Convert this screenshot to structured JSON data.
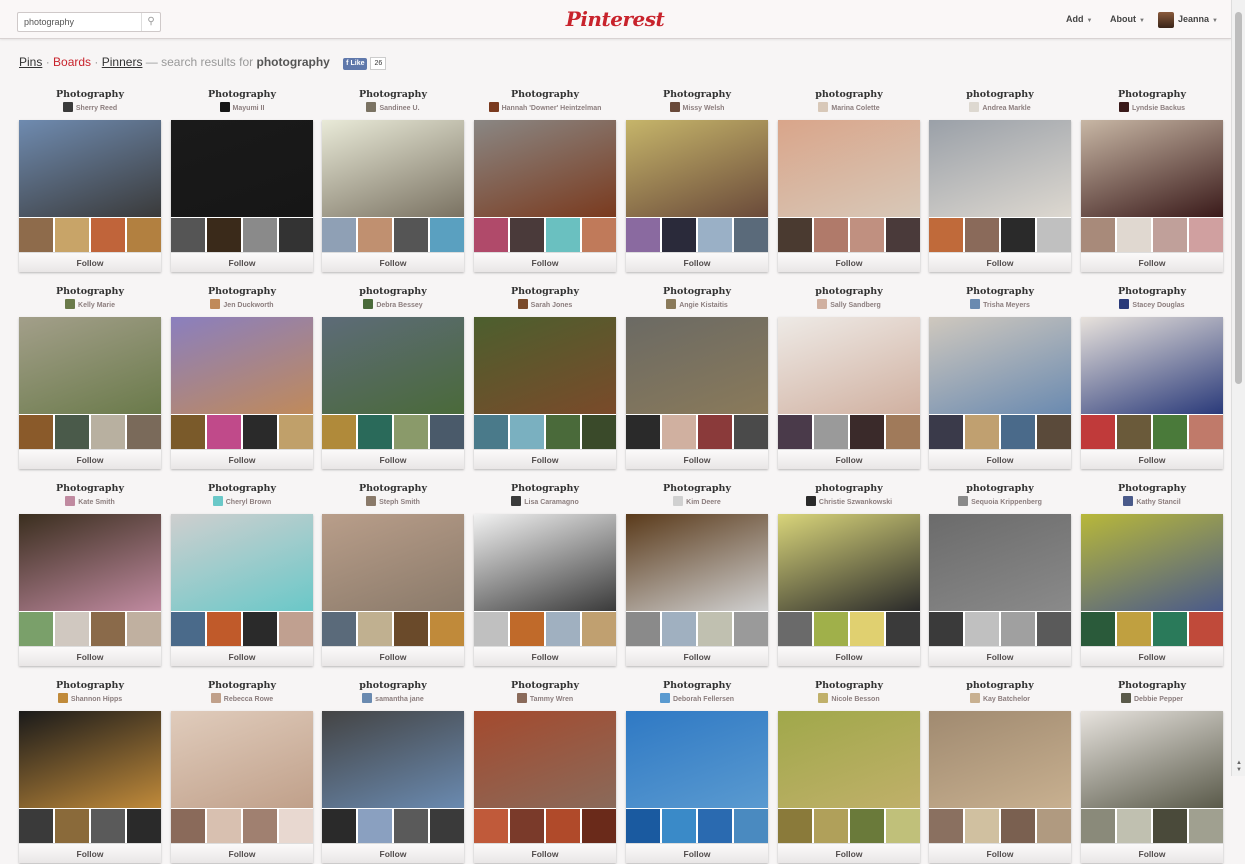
{
  "header": {
    "search_value": "photography",
    "search_icon": "search-icon",
    "logo": "Pinterest",
    "add_label": "Add",
    "about_label": "About",
    "user_name": "Jeanna"
  },
  "results": {
    "pins": "Pins",
    "boards": "Boards",
    "pinners": "Pinners",
    "prefix": "— search results for",
    "query": "photography",
    "like_label": "Like",
    "like_count": "26"
  },
  "follow_label": "Follow",
  "boards": [
    {
      "title": "Photography",
      "owner": "Sherry Reed",
      "colors": [
        "#6f8bb0",
        "#3a3a3a",
        "#8e6b4b",
        "#c8a468",
        "#c0643a",
        "#b28040"
      ]
    },
    {
      "title": "Photography",
      "owner": "Mayumi II",
      "colors": [
        "#1a1a1a",
        "#161616",
        "#555555",
        "#3a2a1a",
        "#8a8a8a",
        "#333333"
      ]
    },
    {
      "title": "Photography",
      "owner": "Sandinee U.",
      "colors": [
        "#e9ead8",
        "#7a7262",
        "#8fa0b5",
        "#c09070",
        "#555555",
        "#5aa0c0"
      ]
    },
    {
      "title": "Photography",
      "owner": "Hannah 'Downer' Heintzelman",
      "colors": [
        "#8a8784",
        "#7a3a1e",
        "#b04a6a",
        "#4a3a3a",
        "#6ac0c0",
        "#c07a5a"
      ]
    },
    {
      "title": "Photography",
      "owner": "Missy Welsh",
      "colors": [
        "#c6b56a",
        "#6a4a3a",
        "#8a6aa0",
        "#2a2a3a",
        "#9ab0c6",
        "#5a6a7a"
      ]
    },
    {
      "title": "photography",
      "owner": "Marina Colette",
      "colors": [
        "#d9a58a",
        "#d8c8b8",
        "#4a3a30",
        "#b07a6a",
        "#c09080",
        "#4a3a3a"
      ]
    },
    {
      "title": "photography",
      "owner": "Andrea Markle",
      "colors": [
        "#9aa0a8",
        "#ddd8d0",
        "#c06a3a",
        "#8a6a5a",
        "#2a2a2a",
        "#c0c0c0"
      ]
    },
    {
      "title": "Photography",
      "owner": "Lyndsie Backus",
      "colors": [
        "#c8b7a5",
        "#3a1a1a",
        "#a88a7a",
        "#e0d8d0",
        "#c0a09a",
        "#d0a0a0"
      ]
    },
    {
      "title": "Photography",
      "owner": "Kelly Marie",
      "colors": [
        "#a39f8a",
        "#6a7a4a",
        "#8a5a2a",
        "#4a5a4a",
        "#b8b0a0",
        "#7a6a5a"
      ]
    },
    {
      "title": "Photography",
      "owner": "Jen Duckworth",
      "colors": [
        "#8a7fbf",
        "#c08a5a",
        "#7a5a2a",
        "#c04a8a",
        "#2a2a2a",
        "#c0a06a"
      ]
    },
    {
      "title": "photography",
      "owner": "Debra Bessey",
      "colors": [
        "#5d6b78",
        "#4a6a3a",
        "#b08a3a",
        "#2a6a5a",
        "#8a9a6a",
        "#4a5a6a"
      ]
    },
    {
      "title": "Photography",
      "owner": "Sarah Jones",
      "colors": [
        "#4c5f2e",
        "#7a4a2a",
        "#4a7a8a",
        "#7ab0c0",
        "#4a6a3a",
        "#3a4a2a"
      ]
    },
    {
      "title": "Photography",
      "owner": "Angie Kistaitis",
      "colors": [
        "#6b6a64",
        "#8a7a5a",
        "#2a2a2a",
        "#d0b0a0",
        "#8a3a3a",
        "#4a4a4a"
      ]
    },
    {
      "title": "photography",
      "owner": "Sally Sandberg",
      "colors": [
        "#eeeae6",
        "#d0b0a0",
        "#4a3a4a",
        "#9a9a9a",
        "#3a2a2a",
        "#a07a5a"
      ]
    },
    {
      "title": "Photography",
      "owner": "Trisha Meyers",
      "colors": [
        "#cfc8be",
        "#6a8ab0",
        "#3a3a4a",
        "#c0a070",
        "#4a6a8a",
        "#5a4a3a"
      ]
    },
    {
      "title": "Photography",
      "owner": "Stacey Douglas",
      "colors": [
        "#e8e2dc",
        "#2a3a7a",
        "#c03a3a",
        "#6a5a3a",
        "#4a7a3a",
        "#c07a6a"
      ]
    },
    {
      "title": "Photography",
      "owner": "Kate Smith",
      "colors": [
        "#3a2e1e",
        "#c08aa0",
        "#7aa06a",
        "#d0c8c0",
        "#8a6a4a",
        "#c0b0a0"
      ]
    },
    {
      "title": "Photography",
      "owner": "Cheryl Brown",
      "colors": [
        "#cfcfcf",
        "#6ac8c8",
        "#4a6a8a",
        "#c05a2a",
        "#2a2a2a",
        "#c0a090"
      ]
    },
    {
      "title": "Photography",
      "owner": "Steph Smith",
      "colors": [
        "#b99e8a",
        "#8a7a6a",
        "#5a6a7a",
        "#c0b090",
        "#6a4a2a",
        "#c08a3a"
      ]
    },
    {
      "title": "Photography",
      "owner": "Lisa Caramagno",
      "colors": [
        "#f2f2f2",
        "#3a3a3a",
        "#c0c0c0",
        "#c06a2a",
        "#a0b0c0",
        "#c0a070"
      ]
    },
    {
      "title": "Photography",
      "owner": "Kim Deere",
      "colors": [
        "#5a3a1a",
        "#d0d0d0",
        "#8a8a8a",
        "#a0b0c0",
        "#c0c0b0",
        "#9a9a9a"
      ]
    },
    {
      "title": "photography",
      "owner": "Christie Szwankowski",
      "colors": [
        "#d9d57a",
        "#2a2a2a",
        "#6a6a6a",
        "#a0b04a",
        "#e0d070",
        "#3a3a3a"
      ]
    },
    {
      "title": "photography",
      "owner": "Sequoia Krippenberg",
      "colors": [
        "#6b6b6b",
        "#8a8a8a",
        "#3a3a3a",
        "#c0c0c0",
        "#a0a0a0",
        "#5a5a5a"
      ]
    },
    {
      "title": "Photography",
      "owner": "Kathy Stancil",
      "colors": [
        "#b8b83a",
        "#4a5a8a",
        "#2a5a3a",
        "#c0a040",
        "#2a7a5a",
        "#c04a3a"
      ]
    },
    {
      "title": "Photography",
      "owner": "Shannon Hipps",
      "colors": [
        "#1a1a1a",
        "#c08a3a",
        "#3a3a3a",
        "#8a6a3a",
        "#5a5a5a",
        "#2a2a2a"
      ]
    },
    {
      "title": "Photography",
      "owner": "Rebecca Rowe",
      "colors": [
        "#e0ccbc",
        "#c0a08a",
        "#8a6a5a",
        "#d8c0b0",
        "#a08070",
        "#e8d8d0"
      ]
    },
    {
      "title": "photography",
      "owner": "samantha jane",
      "colors": [
        "#444444",
        "#6a8ab0",
        "#2a2a2a",
        "#8aa0c0",
        "#5a5a5a",
        "#3a3a3a"
      ]
    },
    {
      "title": "Photography",
      "owner": "Tammy Wren",
      "colors": [
        "#a44a2e",
        "#8a6a5a",
        "#c05a3a",
        "#7a3a2a",
        "#b04a2a",
        "#6a2a1a"
      ]
    },
    {
      "title": "Photography",
      "owner": "Deborah Fellersen",
      "colors": [
        "#2f79c4",
        "#5a9ad0",
        "#1a5aa0",
        "#3a8ac8",
        "#2a6ab0",
        "#4a8ac0"
      ]
    },
    {
      "title": "Photography",
      "owner": "Nicole Besson",
      "colors": [
        "#a0a84a",
        "#c0b06a",
        "#8a7a3a",
        "#b0a05a",
        "#6a7a3a",
        "#c0c07a"
      ]
    },
    {
      "title": "photography",
      "owner": "Kay Batchelor",
      "colors": [
        "#a08a70",
        "#c8b090",
        "#8a7060",
        "#d0c0a0",
        "#7a6050",
        "#b09a80"
      ]
    },
    {
      "title": "Photography",
      "owner": "Debbie Pepper",
      "colors": [
        "#e7e3de",
        "#5a5a4a",
        "#8a8a7a",
        "#c0c0b0",
        "#4a4a3a",
        "#a0a090"
      ]
    }
  ]
}
